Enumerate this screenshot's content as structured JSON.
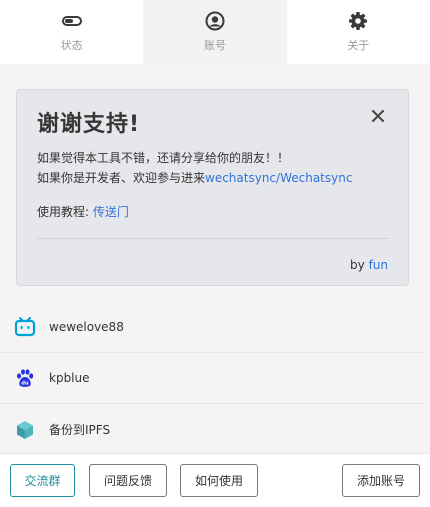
{
  "tabs": [
    {
      "label": "状态",
      "icon": "toggle-icon"
    },
    {
      "label": "账号",
      "icon": "user-circle-icon",
      "active": true
    },
    {
      "label": "关于",
      "icon": "gear-icon"
    }
  ],
  "card": {
    "title": "谢谢支持!",
    "line1": "如果觉得本工具不错，还请分享给你的朋友！！",
    "line2_prefix": "如果你是开发者、欢迎参与进来",
    "line2_link": "wechatsync/Wechatsync",
    "tutorial_prefix": "使用教程: ",
    "tutorial_link": "传送门",
    "footer_prefix": "by ",
    "footer_link": "fun"
  },
  "accounts": [
    {
      "name": "wewelove88",
      "icon": "bilibili-icon"
    },
    {
      "name": "kpblue",
      "icon": "baidu-icon"
    },
    {
      "name": "备份到IPFS",
      "icon": "ipfs-cube-icon"
    }
  ],
  "buttons": {
    "group": "交流群",
    "feedback": "问题反馈",
    "howto": "如何使用",
    "add_account": "添加账号"
  },
  "colors": {
    "link": "#3273dc",
    "primary": "#1f8f9f",
    "bilibili": "#00a1d6",
    "baidu": "#2932e1"
  }
}
